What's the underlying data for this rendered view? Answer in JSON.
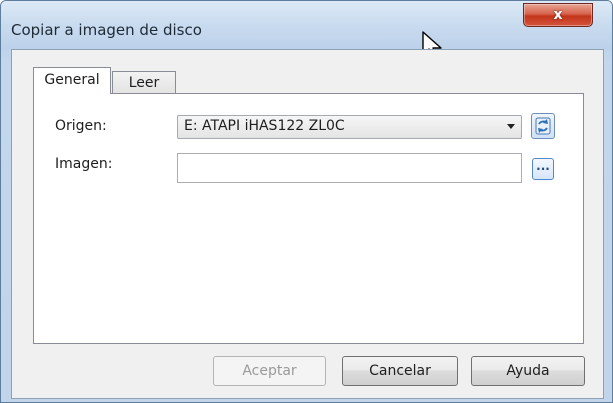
{
  "window": {
    "title": "Copiar a imagen de disco",
    "close_label": "x"
  },
  "tabs": [
    {
      "label": "General",
      "active": true
    },
    {
      "label": "Leer",
      "active": false
    }
  ],
  "form": {
    "origin_label": "Origen:",
    "origin_value": "E: ATAPI iHAS122 ZL0C",
    "image_label": "Imagen:",
    "image_value": "",
    "browse_label": "..."
  },
  "buttons": {
    "accept": "Aceptar",
    "cancel": "Cancelar",
    "help": "Ayuda"
  },
  "colors": {
    "title_bar": "#c9dbef",
    "close_button": "#c2361c"
  },
  "icons": {
    "refresh": "refresh-icon",
    "cursor": "mouse-pointer-icon"
  }
}
